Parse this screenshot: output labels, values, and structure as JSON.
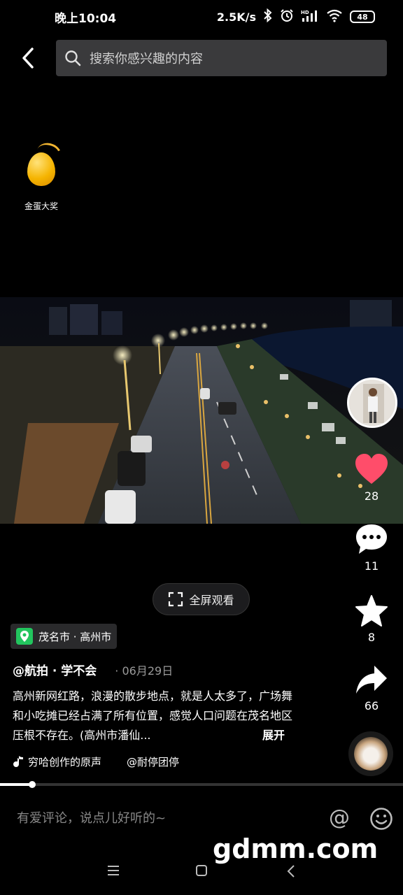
{
  "status_bar": {
    "time": "晚上10:04",
    "network_speed": "2.5K/s",
    "battery": "48"
  },
  "search": {
    "placeholder": "搜索你感兴趣的内容"
  },
  "reward": {
    "label": "金蛋大奖"
  },
  "actions": {
    "likes": "28",
    "comments": "11",
    "favorites": "8",
    "shares": "66"
  },
  "fullscreen": {
    "label": "全屏观看"
  },
  "post": {
    "location": "茂名市 · 高州市",
    "author": "@航拍 · 学不会",
    "date": "06月29日",
    "description": "高州新网红路，浪漫的散步地点，就是人太多了，广场舞和小吃摊已经占满了所有位置，感觉人口问题在茂名地区压根不存在。(高州市潘仙...",
    "expand_label": "展开",
    "music_text": "穷哈创作的原声",
    "music_creator": "@耐停团停"
  },
  "progress": {
    "fraction": 0.08
  },
  "comment": {
    "placeholder": "有爱评论，说点儿好听的~"
  },
  "watermark": "gdmm.com",
  "colors": {
    "like_heart": "#ff4d6a",
    "egg": "#f5b400",
    "location_pin": "#22c55e"
  }
}
